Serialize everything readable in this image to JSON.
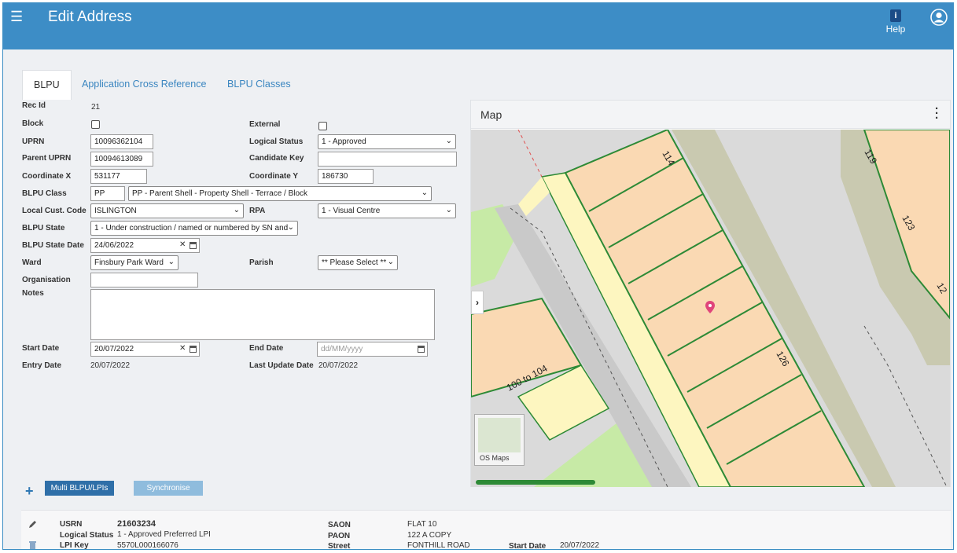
{
  "header": {
    "menu_icon": "hamburger-icon",
    "title": "Edit Address",
    "help_label": "Help",
    "help_icon": "info-icon",
    "user_icon": "user-icon"
  },
  "tabs": [
    {
      "label": "BLPU"
    },
    {
      "label": "Application Cross Reference"
    },
    {
      "label": "BLPU Classes"
    }
  ],
  "form": {
    "rec_id_label": "Rec Id",
    "rec_id": "21",
    "block_label": "Block",
    "external_label": "External",
    "uprn_label": "UPRN",
    "uprn": "10096362104",
    "logical_status_label": "Logical Status",
    "logical_status": "1 - Approved",
    "parent_uprn_label": "Parent UPRN",
    "parent_uprn": "10094613089",
    "candidate_key_label": "Candidate Key",
    "candidate_key": "",
    "coord_x_label": "Coordinate X",
    "coord_x": "531177",
    "coord_y_label": "Coordinate Y",
    "coord_y": "186730",
    "blpu_class_label": "BLPU Class",
    "blpu_class_code": "PP",
    "blpu_class": "PP - Parent Shell - Property Shell - Terrace / Block",
    "local_cust_label": "Local Cust. Code",
    "local_cust": "ISLINGTON",
    "rpa_label": "RPA",
    "rpa": "1 - Visual Centre",
    "blpu_state_label": "BLPU State",
    "blpu_state": "1 - Under construction / named or numbered by SN and",
    "blpu_state_date_label": "BLPU State Date",
    "blpu_state_date": "24/06/2022",
    "ward_label": "Ward",
    "ward": "Finsbury Park Ward",
    "parish_label": "Parish",
    "parish": "** Please Select **",
    "organisation_label": "Organisation",
    "organisation": "",
    "notes_label": "Notes",
    "start_date_label": "Start Date",
    "start_date": "20/07/2022",
    "end_date_label": "End Date",
    "end_date_placeholder": "dd/MM/yyyy",
    "entry_date_label": "Entry Date",
    "entry_date": "20/07/2022",
    "last_update_label": "Last Update Date",
    "last_update": "20/07/2022"
  },
  "map": {
    "title": "Map",
    "menu_icon": "kebab-menu-icon",
    "expand_icon": "chevron-right-icon",
    "basemap_label": "OS Maps",
    "labels": {
      "l114": "114",
      "l119": "119",
      "l123": "123",
      "l12x": "12",
      "l126": "126",
      "l100": "100 to 104"
    },
    "colors": {
      "building": "#fad9b3",
      "road": "#dadada",
      "pavement": "#fdf6c0",
      "park": "#c7eaa6",
      "outline": "#2d8a36",
      "pin": "#e0457b"
    }
  },
  "actions": {
    "add_icon": "plus-icon",
    "multi_label": "Multi BLPU/LPIs",
    "sync_label": "Synchronise"
  },
  "lpi": {
    "edit_icon": "pencil-icon",
    "delete_icon": "trash-icon",
    "usrn_label": "USRN",
    "usrn": "21603234",
    "logical_status_label": "Logical Status",
    "logical_status": "1 - Approved Preferred LPI",
    "lpi_key_label": "LPI Key",
    "lpi_key": "5570L000166076",
    "saon_label": "SAON",
    "saon": "FLAT 10",
    "paon_label": "PAON",
    "paon": "122 A COPY",
    "street_label": "Street",
    "street": "FONTHILL ROAD",
    "start_date_label": "Start Date",
    "start_date": "20/07/2022"
  }
}
